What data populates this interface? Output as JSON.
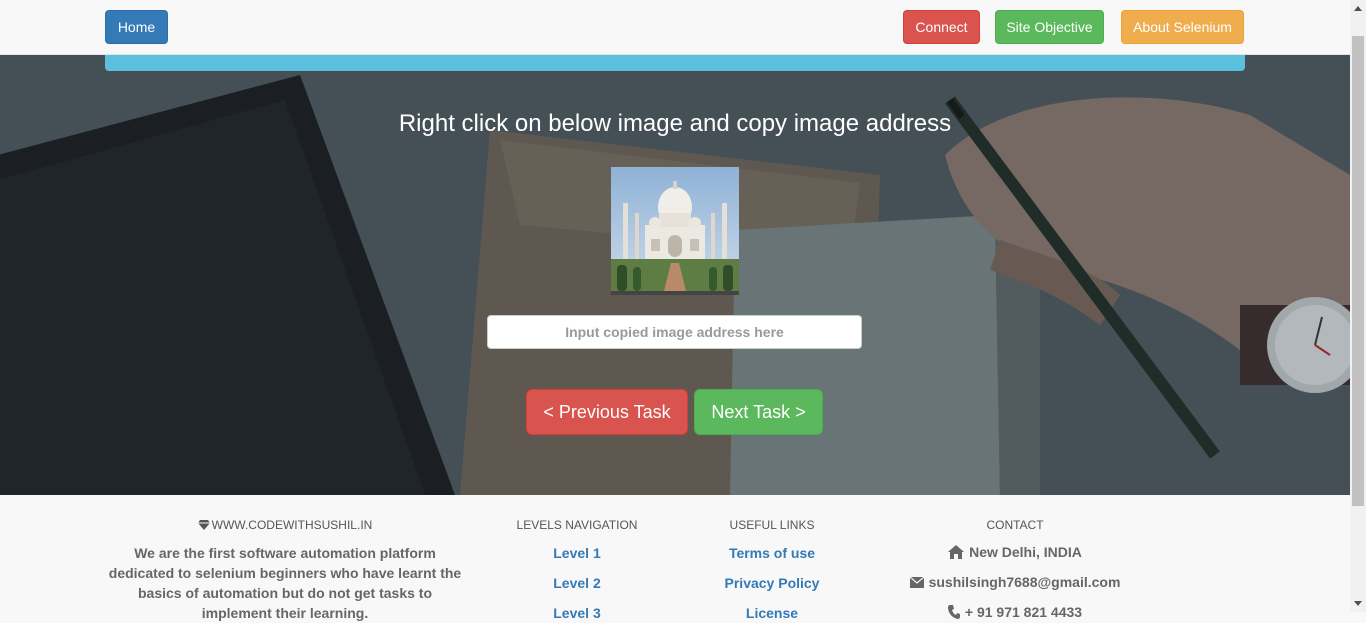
{
  "navbar": {
    "home": "Home",
    "connect": "Connect",
    "site_objective": "Site Objective",
    "about": "About Selenium"
  },
  "task": {
    "title": "Right click on below image and copy image address",
    "image_alt": "Taj Mahal",
    "input_placeholder": "Input copied image address here",
    "input_value": "",
    "prev": "< Previous Task",
    "next": "Next Task >"
  },
  "footer": {
    "brand": {
      "icon": "diamond-icon",
      "heading": "WWW.CODEWITHSUSHIL.IN",
      "text": "We are the first software automation platform dedicated to selenium beginners who have learnt the basics of automation but do not get tasks to implement their learning."
    },
    "levels": {
      "heading": "LEVELS NAVIGATION",
      "items": [
        "Level 1",
        "Level 2",
        "Level 3"
      ]
    },
    "useful": {
      "heading": "USEFUL LINKS",
      "items": [
        "Terms of use",
        "Privacy Policy",
        "License"
      ]
    },
    "contact": {
      "heading": "CONTACT",
      "location": "New Delhi, INDIA",
      "email": "sushilsingh7688@gmail.com",
      "phone": "+ 91 971 821 4433"
    }
  },
  "colors": {
    "primary": "#337ab7",
    "danger": "#d9534f",
    "success": "#5cb85c",
    "warning": "#f0ad4e",
    "info": "#5bc0de"
  }
}
